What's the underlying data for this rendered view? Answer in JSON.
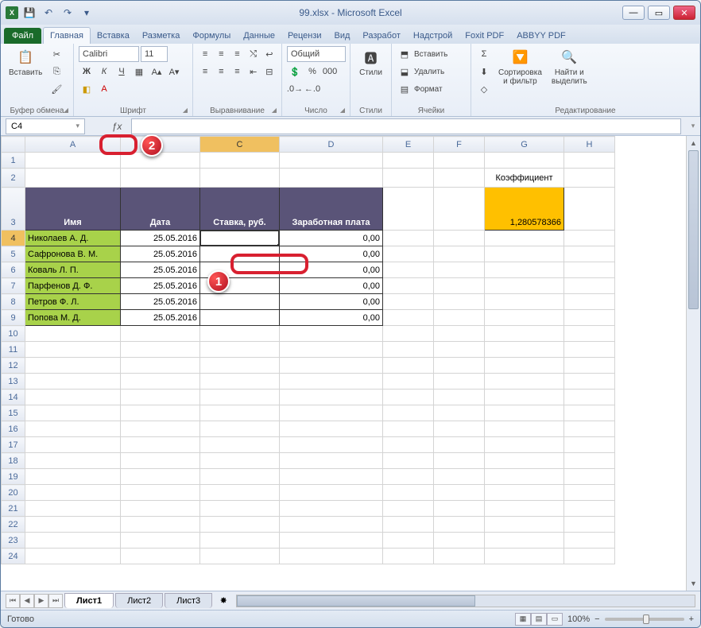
{
  "title": "99.xlsx - Microsoft Excel",
  "qat": {
    "save": "💾",
    "undo": "↶",
    "redo": "↷"
  },
  "tabs": {
    "file": "Файл",
    "home": "Главная",
    "insert": "Вставка",
    "layout": "Разметка",
    "formulas": "Формулы",
    "data": "Данные",
    "review": "Рецензи",
    "view": "Вид",
    "dev": "Разработ",
    "addins": "Надстрой",
    "foxit": "Foxit PDF",
    "abbyy": "ABBYY PDF"
  },
  "ribbon": {
    "clipboard": {
      "label": "Буфер обмена",
      "paste": "Вставить"
    },
    "font": {
      "label": "Шрифт",
      "name": "Calibri",
      "size": "11"
    },
    "align": {
      "label": "Выравнивание"
    },
    "number": {
      "label": "Число",
      "format": "Общий"
    },
    "styles": {
      "label": "Стили",
      "stylesBtn": "Стили"
    },
    "cells": {
      "label": "Ячейки",
      "insert": "Вставить",
      "delete": "Удалить",
      "format": "Формат"
    },
    "editing": {
      "label": "Редактирование",
      "sort": "Сортировка\nи фильтр",
      "find": "Найти и\nвыделить"
    }
  },
  "namebox": "C4",
  "columns": [
    "A",
    "B",
    "C",
    "D",
    "E",
    "F",
    "G",
    "H"
  ],
  "headers": {
    "name": "Имя",
    "date": "Дата",
    "rate": "Ставка, руб.",
    "wage": "Заработная плата"
  },
  "coef_label": "Коэффициент",
  "coef_value": "1,280578366",
  "rows": [
    {
      "n": "4",
      "name": "Николаев А. Д.",
      "date": "25.05.2016",
      "rate": "",
      "wage": "0,00"
    },
    {
      "n": "5",
      "name": "Сафронова В. М.",
      "date": "25.05.2016",
      "rate": "",
      "wage": "0,00"
    },
    {
      "n": "6",
      "name": "Коваль Л. П.",
      "date": "25.05.2016",
      "rate": "",
      "wage": "0,00"
    },
    {
      "n": "7",
      "name": "Парфенов Д. Ф.",
      "date": "25.05.2016",
      "rate": "",
      "wage": "0,00"
    },
    {
      "n": "8",
      "name": "Петров Ф. Л.",
      "date": "25.05.2016",
      "rate": "",
      "wage": "0,00"
    },
    {
      "n": "9",
      "name": "Попова М. Д.",
      "date": "25.05.2016",
      "rate": "",
      "wage": "0,00"
    }
  ],
  "sheets": {
    "s1": "Лист1",
    "s2": "Лист2",
    "s3": "Лист3"
  },
  "status": {
    "ready": "Готово",
    "zoom": "100%"
  },
  "callouts": {
    "c1": "1",
    "c2": "2"
  }
}
